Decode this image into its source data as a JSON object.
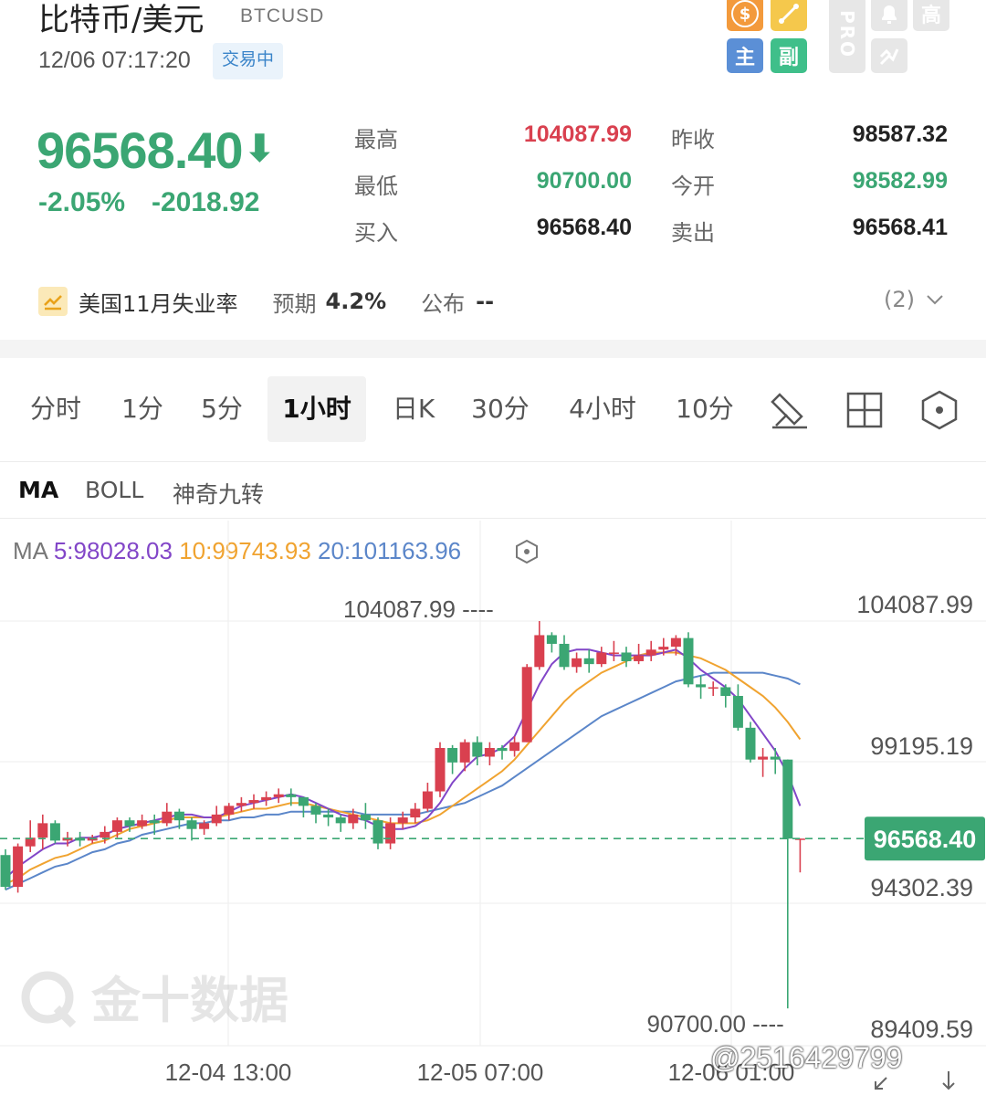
{
  "header": {
    "title": "比特币/美元",
    "ticker": "BTCUSD",
    "datetime": "12/06 07:17:20",
    "status_badge": "交易中",
    "toolbar": [
      {
        "icon": "dollar-icon",
        "label": "$",
        "color": "#f39a3c"
      },
      {
        "icon": "draw-line-icon",
        "label": "",
        "color": "#f5c84c"
      },
      {
        "icon": "main-chart-icon",
        "label": "主",
        "color": "#5b8fd6"
      },
      {
        "icon": "sub-chart-icon",
        "label": "副",
        "color": "#3fbf8a"
      },
      {
        "icon": "pro-icon",
        "label": "PRO"
      },
      {
        "icon": "alarm-icon",
        "label": ""
      },
      {
        "icon": "high-icon",
        "label": "高"
      },
      {
        "icon": "share-icon",
        "label": ""
      }
    ]
  },
  "quote": {
    "price": "96568.40",
    "change_pct": "-2.05%",
    "change_abs": "-2018.92",
    "stats": [
      {
        "label": "最高",
        "value": "104087.99",
        "color": "#d9404f"
      },
      {
        "label": "昨收",
        "value": "98587.32",
        "color": "#222222"
      },
      {
        "label": "最低",
        "value": "90700.00",
        "color": "#3ba673"
      },
      {
        "label": "今开",
        "value": "98582.99",
        "color": "#3ba673"
      },
      {
        "label": "买入",
        "value": "96568.40",
        "color": "#222222"
      },
      {
        "label": "卖出",
        "value": "96568.41",
        "color": "#222222"
      }
    ]
  },
  "event": {
    "name": "美国11月失业率",
    "forecast_label": "预期",
    "forecast_value": "4.2%",
    "publish_label": "公布",
    "publish_value": "--",
    "count": "(2)"
  },
  "period_tabs": [
    "分时",
    "1分",
    "5分",
    "1小时",
    "日K",
    "30分",
    "4小时",
    "10分"
  ],
  "active_period": "1小时",
  "indicator_tabs": [
    "MA",
    "BOLL",
    "神奇九转"
  ],
  "active_indicator": "MA",
  "ma_legend": {
    "prefix": "MA",
    "ma5": "5:98028.03",
    "ma10": "10:99743.93",
    "ma20": "20:101163.96"
  },
  "colors": {
    "up": "#d9404f",
    "down": "#3ba673",
    "ma5": "#8246c8",
    "ma10": "#f0a330",
    "ma20": "#5b86c9"
  },
  "watermark": "金十数据",
  "user_tag": "@2516429799",
  "chart_data": {
    "type": "candlestick",
    "y_axis_labels": [
      "104087.99",
      "99195.19",
      "94302.39",
      "89409.59"
    ],
    "ylim": [
      89409.59,
      104087.99
    ],
    "x_tick_labels": [
      "12-04 13:00",
      "12-05 07:00",
      "12-06 01:00"
    ],
    "current_price": 96568.4,
    "current_price_label": "96568.40",
    "max_marker": {
      "label": "104087.99",
      "value": 104087.99
    },
    "min_marker": {
      "label": "90700.00",
      "value": 90700.0
    },
    "candles": [
      [
        96000,
        94900,
        96200,
        94800
      ],
      [
        94900,
        96300,
        96400,
        94700
      ],
      [
        96300,
        96600,
        97200,
        96100
      ],
      [
        96600,
        97100,
        97400,
        96200
      ],
      [
        97100,
        96500,
        97200,
        96400
      ],
      [
        96500,
        96600,
        96800,
        96300
      ],
      [
        96600,
        96500,
        96800,
        96300
      ],
      [
        96500,
        96600,
        96700,
        96400
      ],
      [
        96600,
        96800,
        97000,
        96400
      ],
      [
        96800,
        97200,
        97300,
        96600
      ],
      [
        97200,
        97000,
        97300,
        96800
      ],
      [
        97000,
        97200,
        97400,
        96900
      ],
      [
        97200,
        97100,
        97400,
        96700
      ],
      [
        97100,
        97500,
        97800,
        97000
      ],
      [
        97500,
        97200,
        97600,
        96900
      ],
      [
        97200,
        96900,
        97300,
        96500
      ],
      [
        96900,
        97100,
        97200,
        96700
      ],
      [
        97100,
        97400,
        97700,
        97000
      ],
      [
        97400,
        97700,
        97800,
        97200
      ],
      [
        97700,
        97800,
        98000,
        97500
      ],
      [
        97800,
        97900,
        98100,
        97600
      ],
      [
        97900,
        98000,
        98200,
        97700
      ],
      [
        98000,
        98100,
        98300,
        97800
      ],
      [
        98100,
        98000,
        98300,
        97700
      ],
      [
        98000,
        97700,
        98000,
        97300
      ],
      [
        97700,
        97400,
        97800,
        97100
      ],
      [
        97400,
        97300,
        97600,
        97000
      ],
      [
        97300,
        97100,
        97400,
        96800
      ],
      [
        97100,
        97400,
        97600,
        96900
      ],
      [
        97400,
        97200,
        97800,
        96900
      ],
      [
        97200,
        96400,
        97300,
        96200
      ],
      [
        96400,
        97100,
        97300,
        96200
      ],
      [
        97100,
        97300,
        97500,
        96900
      ],
      [
        97300,
        97600,
        97800,
        97100
      ],
      [
        97600,
        98200,
        98500,
        97500
      ],
      [
        98200,
        99700,
        99900,
        98000
      ],
      [
        99700,
        99200,
        99800,
        98800
      ],
      [
        99200,
        99900,
        100000,
        98900
      ],
      [
        99900,
        99400,
        100100,
        99100
      ],
      [
        99400,
        99700,
        99900,
        99100
      ],
      [
        99700,
        99600,
        99800,
        99300
      ],
      [
        99600,
        99900,
        100100,
        99400
      ],
      [
        99900,
        102500,
        102600,
        99900
      ],
      [
        102500,
        103600,
        104087.99,
        102400
      ],
      [
        103600,
        103300,
        103700,
        103000
      ],
      [
        103300,
        102500,
        103600,
        102400
      ],
      [
        102500,
        102800,
        103000,
        102300
      ],
      [
        102800,
        102600,
        103100,
        102300
      ],
      [
        102600,
        103000,
        103200,
        102500
      ],
      [
        103000,
        103000,
        103400,
        102700
      ],
      [
        103000,
        102700,
        103200,
        102500
      ],
      [
        102700,
        102900,
        103300,
        102600
      ],
      [
        102900,
        103100,
        103400,
        102700
      ],
      [
        103100,
        103200,
        103500,
        102900
      ],
      [
        103200,
        103500,
        103600,
        102900
      ],
      [
        103500,
        101900,
        103700,
        101800
      ],
      [
        101900,
        101800,
        102200,
        101400
      ],
      [
        101800,
        101800,
        102000,
        101500
      ],
      [
        101800,
        101500,
        101900,
        101100
      ],
      [
        101500,
        100400,
        101900,
        100300
      ],
      [
        100400,
        99300,
        100600,
        99200
      ],
      [
        99300,
        99400,
        99700,
        98700
      ],
      [
        99400,
        99300,
        99700,
        98800
      ],
      [
        99300,
        96568.4,
        99300,
        90700
      ],
      [
        96568.4,
        96568.4,
        96568.4,
        95400
      ]
    ],
    "ma5": [
      95200,
      95600,
      95900,
      96200,
      96400,
      96400,
      96600,
      96600,
      96700,
      96900,
      97000,
      97100,
      97200,
      97300,
      97400,
      97400,
      97300,
      97300,
      97500,
      97700,
      97800,
      97900,
      98000,
      98100,
      98000,
      97800,
      97600,
      97400,
      97300,
      97200,
      97000,
      96900,
      96900,
      97000,
      97300,
      97800,
      98500,
      99000,
      99400,
      99500,
      99700,
      100100,
      101000,
      101900,
      102600,
      103000,
      103100,
      103100,
      103000,
      102900,
      102900,
      102900,
      102900,
      103000,
      103100,
      102800,
      102400,
      102100,
      101800,
      101400,
      100800,
      100200,
      99600,
      98800,
      97700
    ],
    "ma10": [
      95000,
      95200,
      95500,
      95700,
      95900,
      96000,
      96200,
      96400,
      96500,
      96700,
      96900,
      97000,
      97100,
      97200,
      97300,
      97300,
      97300,
      97300,
      97400,
      97500,
      97600,
      97600,
      97700,
      97800,
      97800,
      97700,
      97600,
      97500,
      97400,
      97300,
      97200,
      97100,
      97100,
      97100,
      97200,
      97400,
      97700,
      98000,
      98300,
      98600,
      98900,
      99300,
      99800,
      100300,
      100800,
      101300,
      101700,
      102000,
      102300,
      102500,
      102700,
      102900,
      103000,
      103000,
      103000,
      102900,
      102800,
      102600,
      102400,
      102100,
      101800,
      101500,
      101100,
      100600,
      100000
    ],
    "ma20": [
      94800,
      95000,
      95200,
      95400,
      95600,
      95700,
      95900,
      96100,
      96200,
      96400,
      96500,
      96700,
      96800,
      96900,
      97000,
      97100,
      97100,
      97200,
      97200,
      97300,
      97300,
      97400,
      97400,
      97500,
      97500,
      97500,
      97500,
      97500,
      97500,
      97400,
      97400,
      97400,
      97400,
      97400,
      97500,
      97600,
      97700,
      97800,
      98000,
      98200,
      98400,
      98700,
      99000,
      99300,
      99600,
      99900,
      100200,
      100500,
      100800,
      101000,
      101200,
      101400,
      101600,
      101800,
      102000,
      102100,
      102200,
      102300,
      102300,
      102300,
      102300,
      102300,
      102200,
      102100,
      101900
    ]
  }
}
